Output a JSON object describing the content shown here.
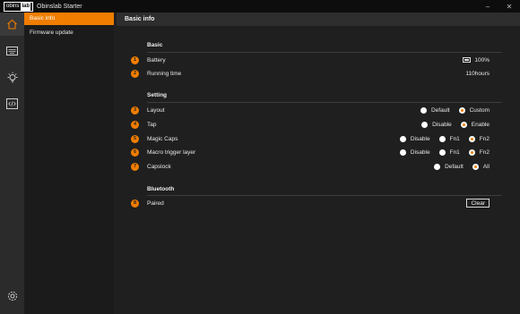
{
  "window": {
    "logo_text": "obins",
    "logo_box": "lab",
    "title": "Obinslab Starter",
    "minimize": "–",
    "close": "✕"
  },
  "rail": {
    "icons": [
      "home-icon",
      "keyboard-icon",
      "lightbulb-icon",
      "code-icon",
      "gear-icon"
    ]
  },
  "menu": {
    "items": [
      {
        "label": "Basic info",
        "active": true
      },
      {
        "label": "Firmware update",
        "active": false
      }
    ]
  },
  "main": {
    "header": "Basic info"
  },
  "sections": {
    "basic": "Basic",
    "setting": "Setting",
    "bluetooth": "Bluetooth"
  },
  "rows": {
    "battery": {
      "num": "1",
      "label": "Battery",
      "value": "100%"
    },
    "running": {
      "num": "2",
      "label": "Running time",
      "value": "110hours"
    },
    "layout": {
      "num": "3",
      "label": "Layout",
      "options": [
        "Default",
        "Custom"
      ],
      "selected": "Custom"
    },
    "tap": {
      "num": "4",
      "label": "Tap",
      "options": [
        "Disable",
        "Enable"
      ],
      "selected": "Enable"
    },
    "magic": {
      "num": "5",
      "label": "Magic Caps",
      "options": [
        "Disable",
        "Fn1",
        "Fn2"
      ],
      "selected": "Fn2"
    },
    "macro": {
      "num": "6",
      "label": "Macro trigger layer",
      "options": [
        "Disable",
        "Fn1",
        "Fn2"
      ],
      "selected": "Fn2"
    },
    "capslock": {
      "num": "7",
      "label": "Capslock",
      "options": [
        "Default",
        "All"
      ],
      "selected": "All"
    },
    "paired": {
      "num": "8",
      "label": "Paired",
      "button": "Clear"
    }
  },
  "colors": {
    "accent": "#f07d00",
    "background": "#1f1f1f",
    "rail": "#2b2b2b",
    "header": "#2e2e2e"
  }
}
